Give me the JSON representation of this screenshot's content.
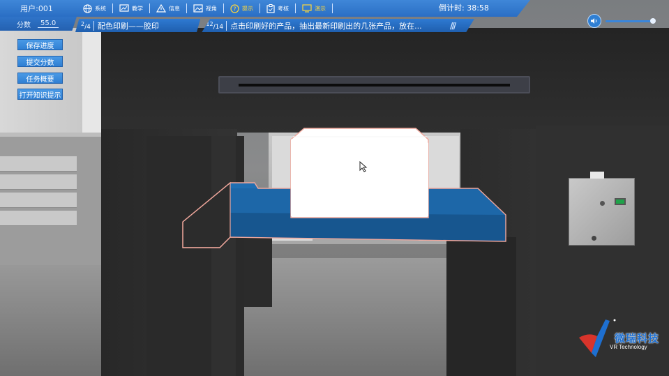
{
  "header": {
    "user_label": "用户:001",
    "score_label": "分数",
    "score_value": "55.0",
    "timer": "倒计时: 38:58"
  },
  "menu": {
    "items": [
      {
        "label": "系统",
        "icon": "globe-icon"
      },
      {
        "label": "教学",
        "icon": "teaching-icon"
      },
      {
        "label": "信息",
        "icon": "warning-icon"
      },
      {
        "label": "视角",
        "icon": "image-icon"
      },
      {
        "label": "提示",
        "icon": "question-icon",
        "active": true
      },
      {
        "label": "考核",
        "icon": "clipboard-icon"
      },
      {
        "label": "演示",
        "icon": "monitor-icon",
        "active": true
      }
    ],
    "active_color": "#ffd83a"
  },
  "task": {
    "stage_num": "2",
    "stage_total": "4",
    "stage_title": "配色印刷——胶印",
    "step_num": "12",
    "step_total": "14",
    "step_text": "点击印刷好的产品，抽出最新印刷出的几张产品，放在..."
  },
  "side_buttons": {
    "save": "保存进度",
    "submit": "提交分数",
    "overview": "任务概要",
    "hints": "打开知识提示"
  },
  "logo": {
    "name": "微瑞科技",
    "subtitle": "VR Technology"
  },
  "colors": {
    "accent": "#2f7fd3",
    "highlight_outline": "#f0a79c",
    "conveyor": "#1f6fb3"
  }
}
